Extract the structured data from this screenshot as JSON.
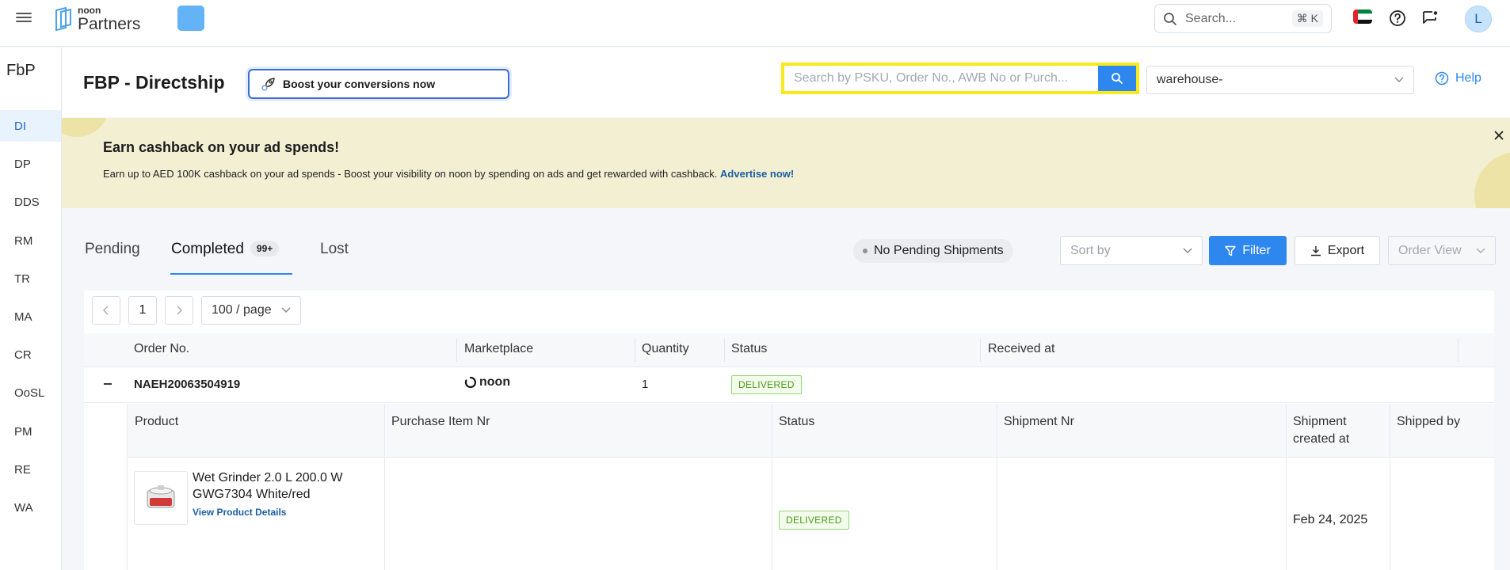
{
  "topbar": {
    "logo_small": "noon",
    "logo_big": "Partners",
    "search_placeholder": "Search...",
    "search_shortcut": "⌘ K",
    "avatar_initial": "L"
  },
  "sidebar": {
    "title": "FbP",
    "items": [
      {
        "label": "DI",
        "active": true
      },
      {
        "label": "DP"
      },
      {
        "label": "DDS"
      },
      {
        "label": "RM"
      },
      {
        "label": "TR"
      },
      {
        "label": "MA"
      },
      {
        "label": "CR"
      },
      {
        "label": "OoSL"
      },
      {
        "label": "PM"
      },
      {
        "label": "RE"
      },
      {
        "label": "WA"
      }
    ]
  },
  "header": {
    "title": "FBP - Directship",
    "boost_label": "Boost your conversions now",
    "order_search_placeholder": "Search by PSKU, Order No., AWB No or Purch...",
    "warehouse_value": "warehouse-",
    "help_label": "Help"
  },
  "banner": {
    "title": "Earn cashback on your ad spends!",
    "text": "Earn up to AED 100K cashback on your ad spends - Boost your visibility on noon by spending on ads and get rewarded with cashback.",
    "link": "Advertise now!"
  },
  "tabs": {
    "pending": "Pending",
    "completed": "Completed",
    "completed_badge": "99+",
    "lost": "Lost"
  },
  "toolbar": {
    "pending_pill": "No Pending Shipments",
    "sort_placeholder": "Sort by",
    "filter_label": "Filter",
    "export_label": "Export",
    "order_view_placeholder": "Order View"
  },
  "pager": {
    "page": "1",
    "per_page": "100 / page"
  },
  "table": {
    "headers": {
      "order_no": "Order No.",
      "marketplace": "Marketplace",
      "quantity": "Quantity",
      "status": "Status",
      "received_at": "Received at"
    },
    "row": {
      "order_no": "NAEH20063504919",
      "marketplace": "noon",
      "quantity": "1",
      "status": "DELIVERED"
    }
  },
  "sub_table": {
    "headers": {
      "product": "Product",
      "purchase_item_nr": "Purchase Item Nr",
      "status": "Status",
      "shipment_nr": "Shipment Nr",
      "shipment_created_line1": "Shipment",
      "shipment_created_line2": "created at",
      "shipped_by": "Shipped by"
    },
    "row": {
      "product_line1": "Wet Grinder 2.0 L 200.0 W",
      "product_line2": "GWG7304 White/red",
      "product_link": "View Product Details",
      "status": "DELIVERED",
      "shipment_created_at": "Feb 24, 2025"
    }
  },
  "colors": {
    "accent": "#2e87ef",
    "search_highlight": "#f8ea19",
    "banner_bg": "#f3efd3",
    "delivered": "#4a9a1d"
  }
}
